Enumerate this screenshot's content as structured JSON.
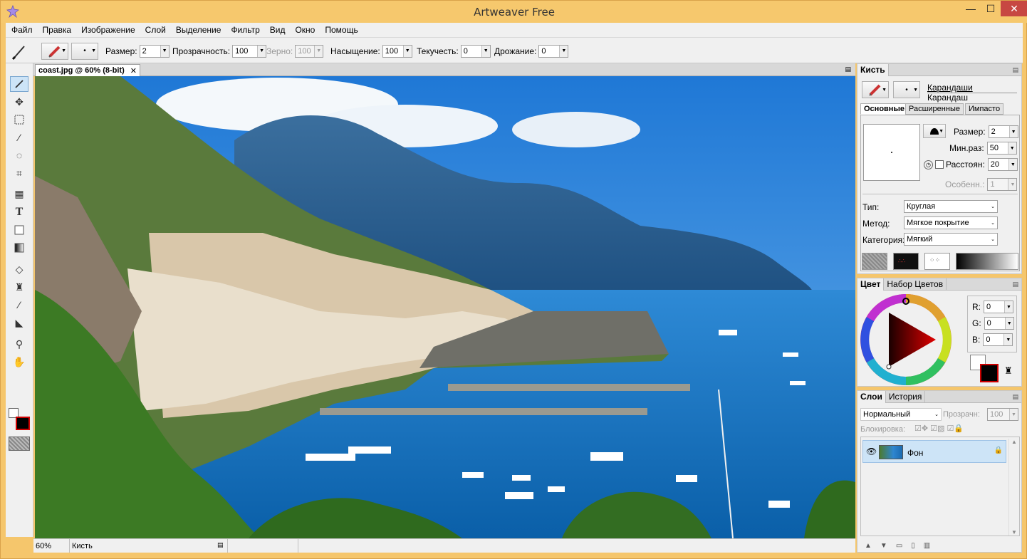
{
  "window": {
    "title": "Artweaver Free",
    "min": "—",
    "max": "☐",
    "close": "✕"
  },
  "menu": [
    "Файл",
    "Правка",
    "Изображение",
    "Слой",
    "Выделение",
    "Фильтр",
    "Вид",
    "Окно",
    "Помощь"
  ],
  "options": {
    "size_label": "Размер:",
    "size_value": "2",
    "opacity_label": "Прозрачность:",
    "opacity_value": "100",
    "grain_label": "Зерно:",
    "grain_value": "100",
    "saturation_label": "Насыщение:",
    "saturation_value": "100",
    "flow_label": "Текучесть:",
    "flow_value": "0",
    "jitter_label": "Дрожание:",
    "jitter_value": "0"
  },
  "document": {
    "tab_title": "coast.jpg @ 60% (8-bit)",
    "close": "✕"
  },
  "status": {
    "zoom": "60%",
    "tool": "Кисть"
  },
  "brush_panel": {
    "tab": "Кисть",
    "category": "Карандаши",
    "variant": "Карандаш",
    "subtabs": [
      "Основные",
      "Расширенные",
      "Импасто"
    ],
    "size_label": "Размер:",
    "size_value": "2",
    "minsize_label": "Мин.раз:",
    "minsize_value": "50",
    "spacing_label": "Расстоян:",
    "spacing_value": "20",
    "feature_label": "Особенн.:",
    "feature_value": "1",
    "type_label": "Тип:",
    "type_value": "Круглая",
    "method_label": "Метод:",
    "method_value": "Мягкое покрытие",
    "category_label": "Категория:",
    "category_value": "Мягкий"
  },
  "color_panel": {
    "tabs": [
      "Цвет",
      "Набор Цветов"
    ],
    "r_label": "R:",
    "r_value": "0",
    "g_label": "G:",
    "g_value": "0",
    "b_label": "B:",
    "b_value": "0",
    "foreground": "#000000",
    "background": "#ffffff"
  },
  "layers_panel": {
    "tabs": [
      "Слои",
      "История"
    ],
    "blend_mode": "Нормальный",
    "opacity_label": "Прозрачн:",
    "opacity_value": "100",
    "lock_label": "Блокировка:",
    "layers": [
      {
        "name": "Фон"
      }
    ]
  }
}
